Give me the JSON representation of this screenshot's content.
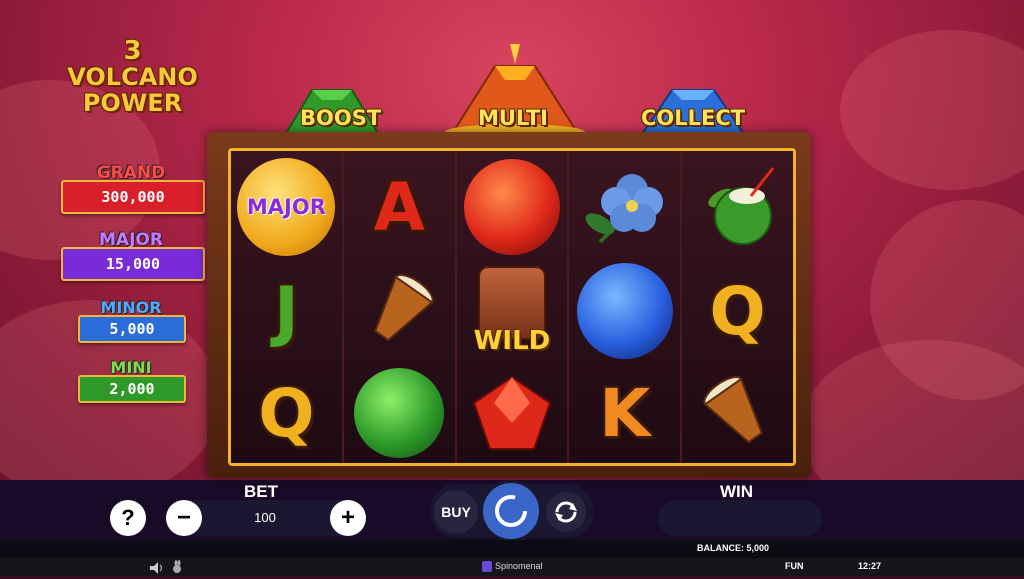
{
  "logo": {
    "line1": "3",
    "line2": "VOLCANO",
    "line3": "POWER"
  },
  "jackpots": [
    {
      "name": "GRAND",
      "value": "300,000",
      "color": "#d81f2a"
    },
    {
      "name": "MAJOR",
      "value": "15,000",
      "color": "#7a2bd8"
    },
    {
      "name": "MINOR",
      "value": "5,000",
      "color": "#2a6cd8"
    },
    {
      "name": "MINI",
      "value": "2,000",
      "color": "#2f9a2a"
    }
  ],
  "volcanoes": [
    {
      "label": "BOOST",
      "color": "#2f9a2a"
    },
    {
      "label": "MULTI",
      "color": "#e0581a"
    },
    {
      "label": "COLLECT",
      "color": "#2a70d8"
    }
  ],
  "reels": [
    [
      "coin-major",
      "J",
      "Q"
    ],
    [
      "A",
      "drum",
      "green-orb"
    ],
    [
      "red-orb",
      "tiki-wild",
      "red-gem"
    ],
    [
      "hibiscus",
      "blue-orb",
      "K"
    ],
    [
      "coconut",
      "Q",
      "drum"
    ]
  ],
  "symbols": {
    "major_coin_text": "MAJOR",
    "wild_text": "WILD"
  },
  "controls": {
    "help": "?",
    "minus": "−",
    "plus": "+",
    "bet_label": "BET",
    "bet_value": "100",
    "buy_label": "BUY",
    "win_label": "WIN",
    "win_value": ""
  },
  "status": {
    "balance": "BALANCE: 5,000"
  },
  "footer": {
    "brand": "Spinomenal",
    "mode": "FUN",
    "time": "12:27"
  }
}
